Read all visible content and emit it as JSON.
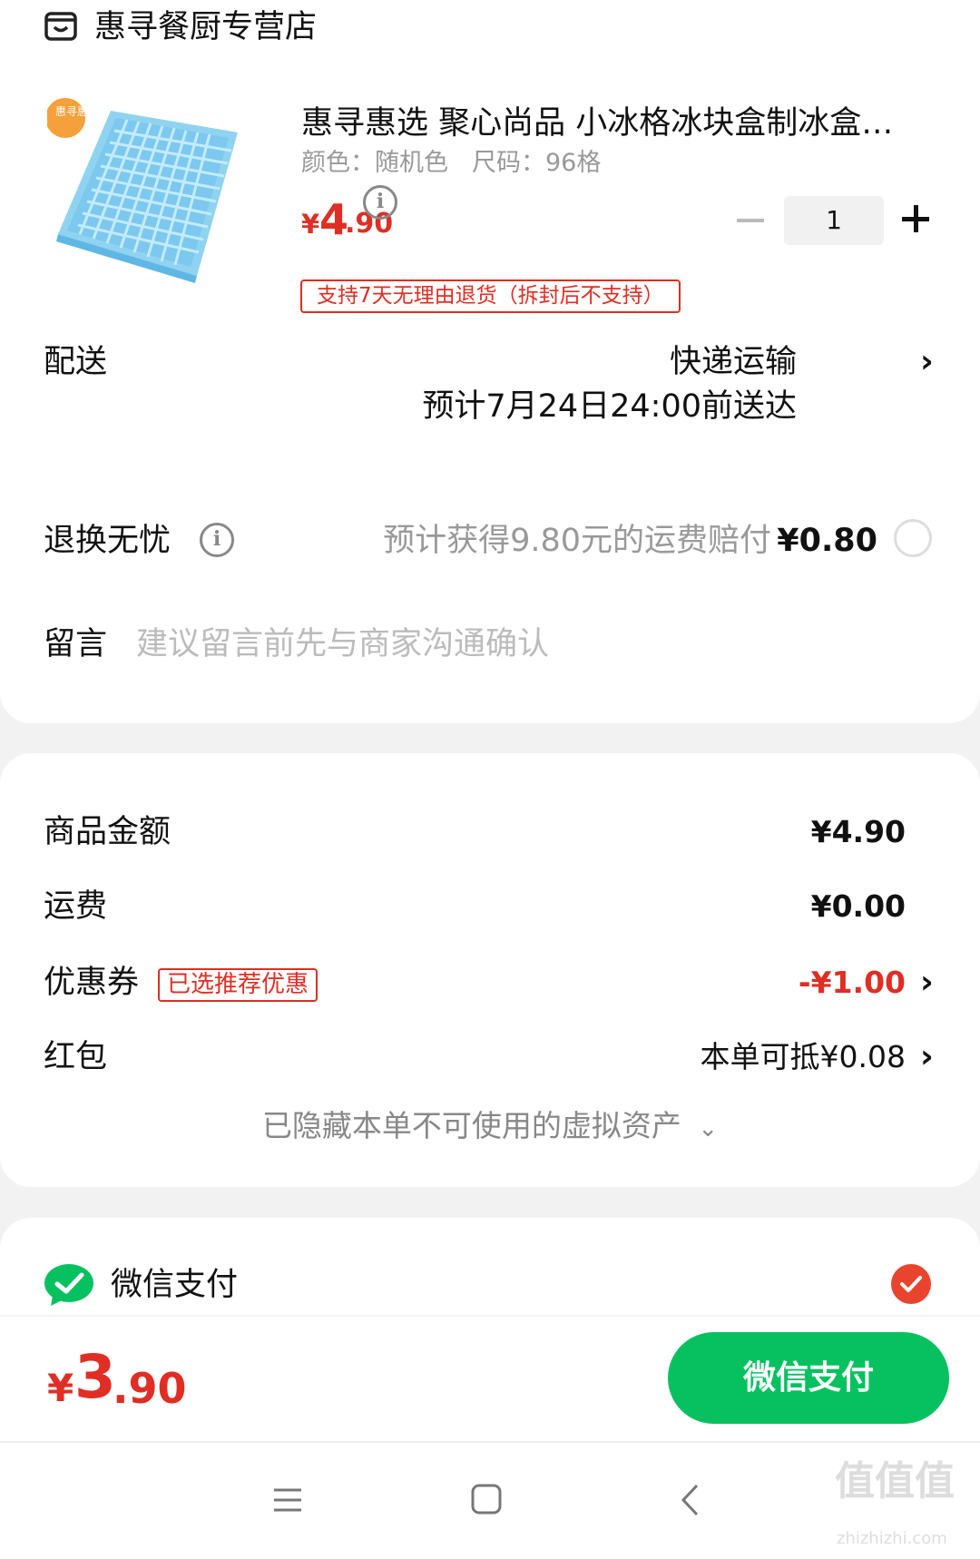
{
  "store": {
    "name": "惠寻餐厨专营店",
    "icon": "store-icon"
  },
  "product": {
    "title": "惠寻惠选 聚心尚品 小冰格冰块盒制冰盒…",
    "image_badge": "惠寻惠选",
    "spec_color": "颜色：随机色",
    "spec_size": "尺码：96格",
    "price_symbol": "¥",
    "price_int": "4",
    "price_dec": ".90",
    "quantity": "1",
    "return_policy": "支持7天无理由退货（拆封后不支持）"
  },
  "delivery": {
    "label": "配送",
    "method": "快递运输",
    "estimate": "预计7月24日24:00前送达"
  },
  "return_insurance": {
    "label": "退换无忧",
    "desc": "预计获得9.80元的运费赔付",
    "price": "¥0.80"
  },
  "message": {
    "label": "留言",
    "placeholder": "建议留言前先与商家沟通确认"
  },
  "summary": {
    "goods_label": "商品金额",
    "goods_value": "¥4.90",
    "shipping_label": "运费",
    "shipping_value": "¥0.00",
    "coupon_label": "优惠券",
    "coupon_tag": "已选推荐优惠",
    "coupon_value": "-¥1.00",
    "redpacket_label": "红包",
    "redpacket_value": "本单可抵¥0.08",
    "hidden_assets": "已隐藏本单不可使用的虚拟资产"
  },
  "payment": {
    "method_label": "微信支付",
    "total_symbol": "¥",
    "total_int": "3",
    "total_dec": ".90",
    "pay_button": "微信支付"
  },
  "watermark": {
    "text": "值值值",
    "sub": "zhizhizhi.com"
  },
  "colors": {
    "accent_red": "#e02e24",
    "wechat_green": "#07c160"
  }
}
